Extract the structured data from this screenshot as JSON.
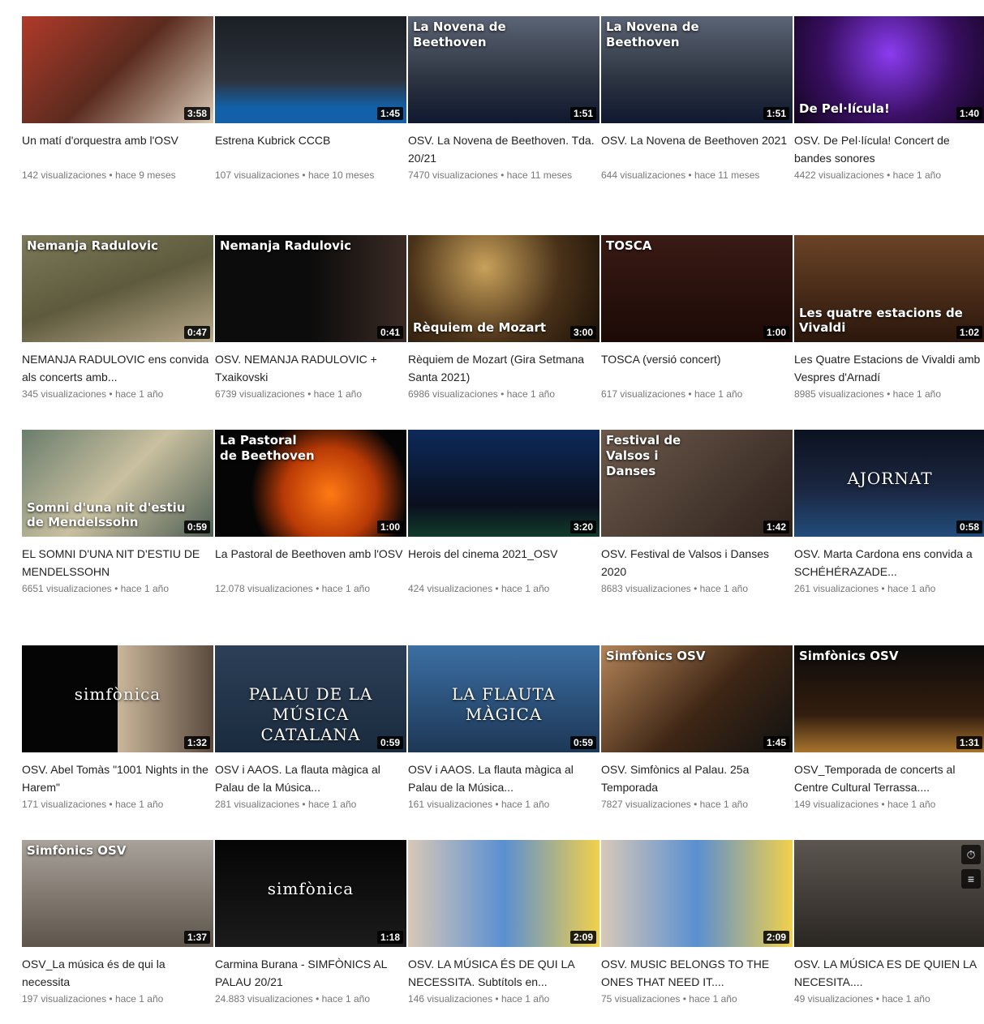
{
  "rows": [
    [
      {
        "title": "Un matí d'orquestra amb l'OSV",
        "views": "142 visualizaciones",
        "age": "hace 9 meses",
        "duration": "3:58",
        "overlay": ""
      },
      {
        "title": "Estrena Kubrick CCCB",
        "views": "107 visualizaciones",
        "age": "hace 10 meses",
        "duration": "1:45",
        "overlay": ""
      },
      {
        "title": "OSV. La Novena de Beethoven. Tda. 20/21",
        "views": "7470 visualizaciones",
        "age": "hace 11 meses",
        "duration": "1:51",
        "overlay": "La Novena de\nBeethoven"
      },
      {
        "title": "OSV. La Novena de Beethoven 2021",
        "views": "644 visualizaciones",
        "age": "hace 11 meses",
        "duration": "1:51",
        "overlay": "La Novena de\nBeethoven"
      },
      {
        "title": "OSV. De Pel·lícula! Concert de bandes sonores",
        "views": "4422 visualizaciones",
        "age": "hace 1 año",
        "duration": "1:40",
        "overlay": "De Pel·lícula!"
      }
    ],
    [
      {
        "title": "NEMANJA RADULOVIC ens convida als concerts amb...",
        "views": "345 visualizaciones",
        "age": "hace 1 año",
        "duration": "0:47",
        "overlay": "Nemanja Radulovic"
      },
      {
        "title": "OSV. NEMANJA RADULOVIC + Txaikovski",
        "views": "6739 visualizaciones",
        "age": "hace 1 año",
        "duration": "0:41",
        "overlay": "Nemanja Radulovic"
      },
      {
        "title": "Rèquiem de Mozart (Gira Setmana Santa 2021)",
        "views": "6986 visualizaciones",
        "age": "hace 1 año",
        "duration": "3:00",
        "overlay": "Rèquiem de Mozart"
      },
      {
        "title": "TOSCA (versió concert)",
        "views": "617 visualizaciones",
        "age": "hace 1 año",
        "duration": "1:00",
        "overlay": "TOSCA"
      },
      {
        "title": "Les Quatre Estacions de Vivaldi amb Vespres d'Arnadí",
        "views": "8985 visualizaciones",
        "age": "hace 1 año",
        "duration": "1:02",
        "overlay": "Les quatre estacions de Vivaldi"
      }
    ],
    [
      {
        "title": "EL SOMNI D'UNA NIT D'ESTIU DE MENDELSSOHN",
        "views": "6651 visualizaciones",
        "age": "hace 1 año",
        "duration": "0:59",
        "overlay": "Somni d'una nit d'estiu\nde Mendelssohn"
      },
      {
        "title": "La Pastoral de Beethoven amb l'OSV",
        "views": "12.078 visualizaciones",
        "age": "hace 1 año",
        "duration": "1:00",
        "overlay": "La Pastoral\nde Beethoven"
      },
      {
        "title": "Herois del cinema 2021_OSV",
        "views": "424 visualizaciones",
        "age": "hace 1 año",
        "duration": "3:20",
        "overlay": ""
      },
      {
        "title": "OSV. Festival de Valsos i Danses 2020",
        "views": "8683 visualizaciones",
        "age": "hace 1 año",
        "duration": "1:42",
        "overlay": "Festival de\nValsos i\nDanses"
      },
      {
        "title": "OSV. Marta Cardona ens convida a SCHÉHÉRAZADE...",
        "views": "261 visualizaciones",
        "age": "hace 1 año",
        "duration": "0:58",
        "overlay": "AJORNAT"
      }
    ],
    [
      {
        "title": "OSV. Abel Tomàs \"1001 Nights in the Harem\"",
        "views": "171 visualizaciones",
        "age": "hace 1 año",
        "duration": "1:32",
        "overlay": "simfònica"
      },
      {
        "title": "OSV i AAOS. La flauta màgica al Palau de la Música...",
        "views": "281 visualizaciones",
        "age": "hace 1 año",
        "duration": "0:59",
        "overlay": "PALAU DE LA MÚSICA CATALANA"
      },
      {
        "title": "OSV i AAOS. La flauta màgica al Palau de la Música...",
        "views": "161 visualizaciones",
        "age": "hace 1 año",
        "duration": "0:59",
        "overlay": "LA FLAUTA MÀGICA"
      },
      {
        "title": "OSV. Simfònics al Palau. 25a Temporada",
        "views": "7827 visualizaciones",
        "age": "hace 1 año",
        "duration": "1:45",
        "overlay": "Simfònics OSV"
      },
      {
        "title": "OSV_Temporada de concerts al Centre Cultural Terrassa....",
        "views": "149 visualizaciones",
        "age": "hace 1 año",
        "duration": "1:31",
        "overlay": "Simfònics OSV"
      }
    ],
    [
      {
        "title": "OSV_La música és de qui la necessita",
        "views": "197 visualizaciones",
        "age": "hace 1 año",
        "duration": "1:37",
        "overlay": "Simfònics OSV"
      },
      {
        "title": "Carmina Burana - SIMFÒNICS AL PALAU 20/21",
        "views": "24.883 visualizaciones",
        "age": "hace 1 año",
        "duration": "1:18",
        "overlay": "simfònica"
      },
      {
        "title": "OSV. LA MÚSICA ÉS DE QUI LA NECESSITA. Subtítols en...",
        "views": "146 visualizaciones",
        "age": "hace 1 año",
        "duration": "2:09",
        "overlay": ""
      },
      {
        "title": "OSV. MUSIC BELONGS TO THE ONES THAT NEED IT....",
        "views": "75 visualizaciones",
        "age": "hace 1 año",
        "duration": "2:09",
        "overlay": ""
      },
      {
        "title": "OSV. LA MÚSICA ES DE QUIEN LA NECESITA....",
        "views": "49 visualizaciones",
        "age": "hace 1 año",
        "duration": "",
        "overlay": ""
      }
    ]
  ],
  "icons": {
    "more": "more-vert-icon",
    "watch_later": "clock-icon",
    "add_queue": "queue-icon"
  },
  "colors": {
    "meta": "#777777",
    "duration_bg": "#000000"
  }
}
